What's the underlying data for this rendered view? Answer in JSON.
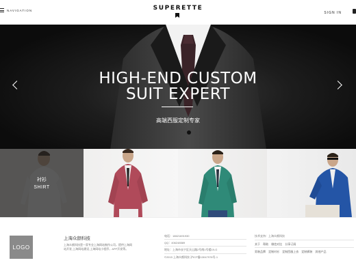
{
  "header": {
    "nav_label": "NAVIGATION",
    "logo": "SUPERETTE",
    "signin": "SIGN IN"
  },
  "hero": {
    "title_line1": "HIGH-END CUSTOM",
    "title_line2": "SUIT EXPERT",
    "subtitle": "高端西服定制专家"
  },
  "categories": [
    {
      "cn": "衬衫",
      "en": "SHIRT"
    }
  ],
  "footer": {
    "logo": "LOGO",
    "company": "上海众颜科技",
    "description": "上海众颜科技是一家专业上海网站制作公司，提供上海网站开发,上海网站建设,上海网站小程序，APP开发等。",
    "contact": {
      "phone": "电话：18621691930",
      "qq": "QQ：406248589",
      "address": "地址：上海市长宁区天山路2号南1号楼19-G",
      "copyright": "©2015 上海众颜科技 沪ICP备13047976号-1"
    },
    "tech_support": "技术支持：上海众颜科技",
    "links_row1": [
      "关于",
      "帮助",
      "微信对比",
      "分享订阅"
    ],
    "links_row2": [
      "男装品牌",
      "定制衬衫",
      "定制西服上衣",
      "定制裤装",
      "其他产品"
    ]
  }
}
